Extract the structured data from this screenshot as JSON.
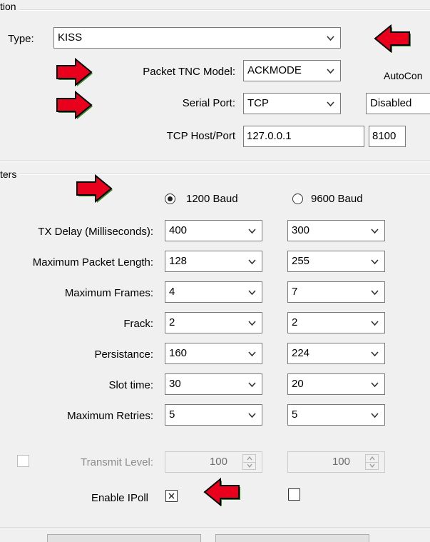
{
  "top_group": {
    "caption": "tion",
    "type_label": "Type:",
    "type_value": "KISS",
    "tnc_model_label": "Packet TNC Model:",
    "tnc_model_value": "ACKMODE",
    "autocon_label": "AutoCon",
    "serial_port_label": "Serial Port:",
    "serial_port_value": "TCP",
    "serial_extra_value": "Disabled",
    "tcp_label": "TCP Host/Port",
    "tcp_host": "127.0.0.1",
    "tcp_port": "8100"
  },
  "params_group": {
    "caption": "ters",
    "baud_1200_label": "1200 Baud",
    "baud_9600_label": "9600 Baud",
    "baud_selected": "1200 Baud",
    "rows": [
      {
        "label": "TX Delay (Milliseconds):",
        "v1200": "400",
        "v9600": "300"
      },
      {
        "label": "Maximum Packet Length:",
        "v1200": "128",
        "v9600": "255"
      },
      {
        "label": "Maximum Frames:",
        "v1200": "4",
        "v9600": "7"
      },
      {
        "label": "Frack:",
        "v1200": "2",
        "v9600": "2"
      },
      {
        "label": "Persistance:",
        "v1200": "160",
        "v9600": "224"
      },
      {
        "label": "Slot time:",
        "v1200": "30",
        "v9600": "20"
      },
      {
        "label": "Maximum Retries:",
        "v1200": "5",
        "v9600": "5"
      }
    ],
    "transmit_level_label": "Transmit Level:",
    "transmit_level_1200": "100",
    "transmit_level_9600": "100",
    "enable_ipoll_label": "Enable IPoll",
    "enable_ipoll_1200_checked": true,
    "enable_ipoll_9600_checked": false
  },
  "colors": {
    "arrow_fill": "#e8001c",
    "arrow_outline": "#000000",
    "arrow_shadow": "#3a8a2a"
  },
  "icons": [
    "chevron-down-icon",
    "red-arrow-right-icon",
    "red-arrow-left-icon",
    "spin-up-icon",
    "spin-down-icon"
  ]
}
